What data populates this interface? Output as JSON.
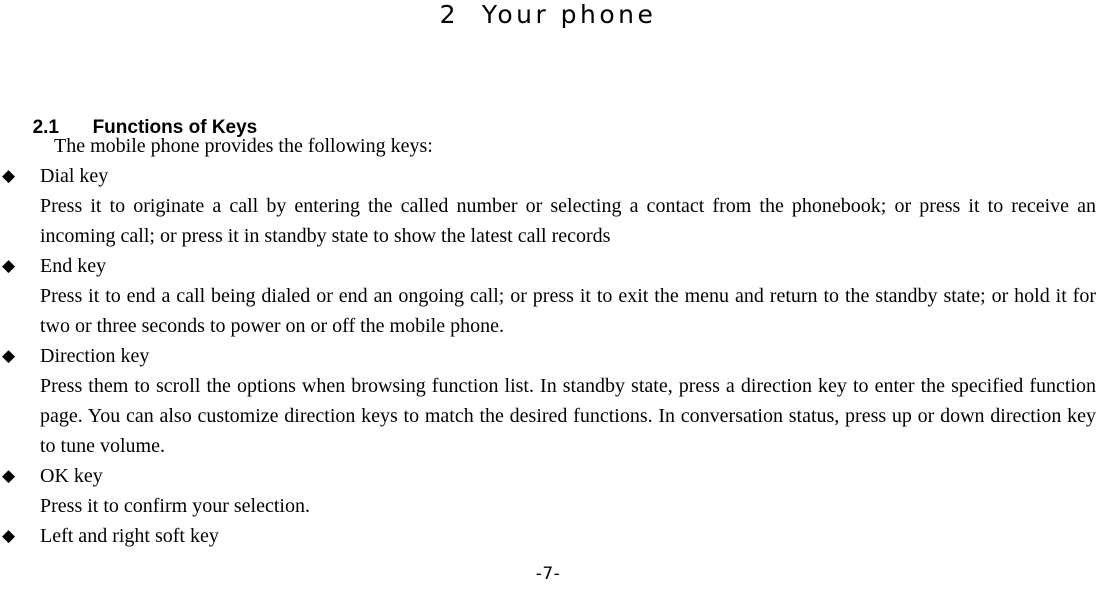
{
  "page": {
    "chapter_title": "2  Your phone",
    "footer": "-7-"
  },
  "section": {
    "number": "2.1",
    "title": "Functions of Keys"
  },
  "content": {
    "intro": "The mobile phone provides the following keys:",
    "bullet_glyph": "◆",
    "items": [
      {
        "label": "Dial key",
        "description": "Press it to originate a call by entering the called number or selecting a contact from the phonebook; or press it to receive an incoming call; or press it in standby state to show the latest call records"
      },
      {
        "label": "End key",
        "description": "Press it to end a call being dialed or end an ongoing call; or press it to exit the menu and return to the standby state; or hold it for two or three seconds to power on or off the mobile phone."
      },
      {
        "label": "Direction key",
        "description": "Press them to scroll the options when browsing function list. In standby state, press a direction key to enter the specified function page. You can also customize direction keys to match the desired functions. In conversation status, press up or down direction key to tune volume."
      },
      {
        "label": "OK key",
        "description": "Press it to confirm your selection."
      },
      {
        "label": "Left and right soft key",
        "description": ""
      }
    ]
  }
}
